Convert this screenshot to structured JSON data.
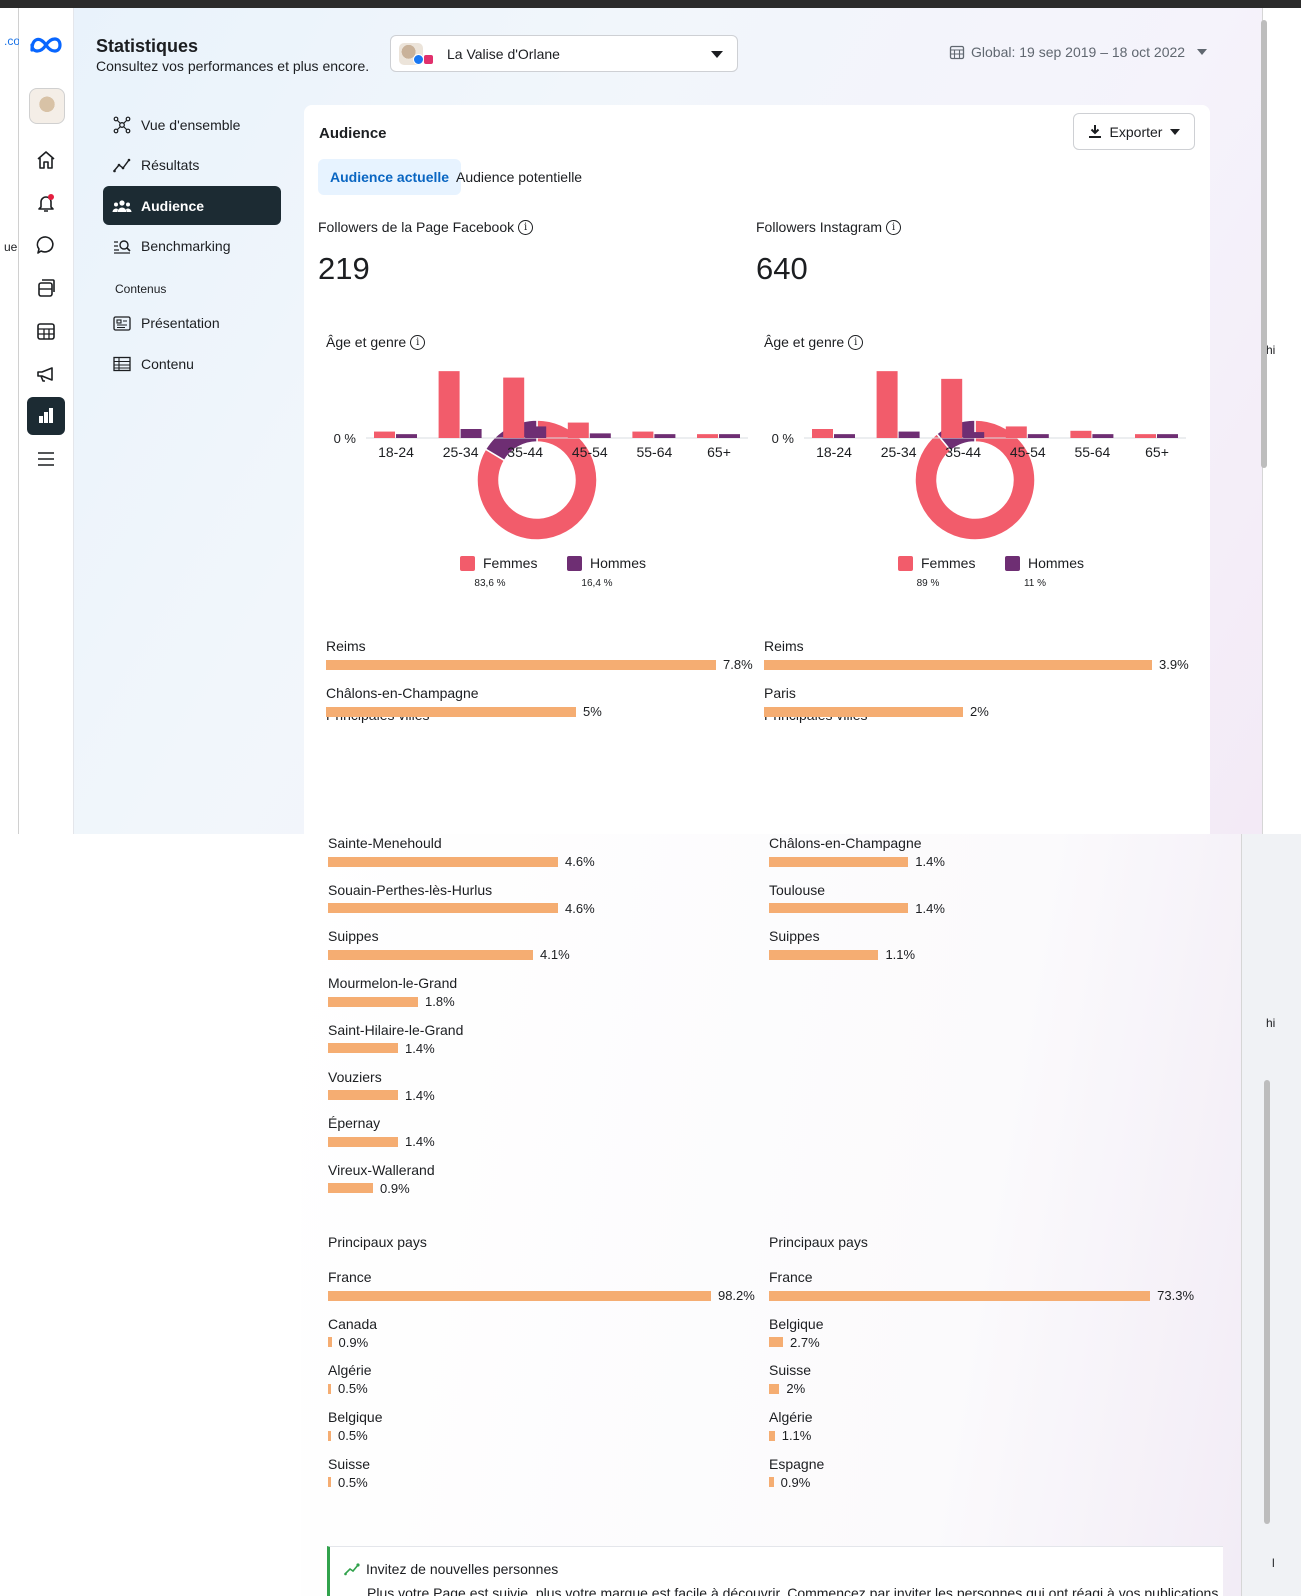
{
  "app": {
    "title": "Statistiques",
    "subtitle": "Consultez vos performances et plus encore."
  },
  "page_selector": {
    "name": "La Valise d'Orlane"
  },
  "date_range": {
    "label": "Global: 19 sep 2019 – 18 oct 2022"
  },
  "left_edge_fragments": [
    ".co",
    "ue"
  ],
  "right_edge_fragments": [
    "hi",
    "hi",
    "l"
  ],
  "rail": {
    "icons": [
      "meta-logo-icon",
      "home-icon",
      "bell-icon",
      "chat-icon",
      "posts-icon",
      "planner-icon",
      "megaphone-icon",
      "insights-icon",
      "menu-icon"
    ]
  },
  "nav": {
    "items": [
      {
        "label": "Vue d'ensemble",
        "icon": "overview-icon"
      },
      {
        "label": "Résultats",
        "icon": "results-icon"
      },
      {
        "label": "Audience",
        "icon": "audience-icon",
        "active": true
      },
      {
        "label": "Benchmarking",
        "icon": "benchmark-icon"
      }
    ],
    "section_label": "Contenus",
    "content_items": [
      {
        "label": "Présentation",
        "icon": "presentation-icon"
      },
      {
        "label": "Contenu",
        "icon": "table-icon"
      }
    ]
  },
  "card": {
    "title": "Audience",
    "export_label": "Exporter",
    "tabs": [
      {
        "label": "Audience actuelle",
        "active": true
      },
      {
        "label": "Audience potentielle",
        "active": false
      }
    ]
  },
  "facebook": {
    "followers_label": "Followers de la Page Facebook",
    "followers_count": "219",
    "age_gender_label": "Âge et genre",
    "cities_label": "Principales villes",
    "countries_label": "Principaux pays"
  },
  "instagram": {
    "followers_label": "Followers Instagram",
    "followers_count": "640",
    "age_gender_label": "Âge et genre",
    "cities_label": "Principales villes",
    "countries_label": "Principaux pays"
  },
  "colors": {
    "women": "#f25c6b",
    "men": "#6e2e73",
    "bar": "#f5ad72",
    "active_nav": "#1c2b33",
    "tab_active_bg": "#e7f3ff",
    "tab_active_text": "#0a66c2"
  },
  "chart_data": [
    {
      "type": "pie",
      "id": "fb-donut",
      "categories": [
        "Femmes",
        "Hommes"
      ],
      "values": [
        83.6,
        16.4
      ],
      "value_labels": [
        "83,6 %",
        "16,4 %"
      ]
    },
    {
      "type": "bar",
      "id": "fb-age",
      "categories": [
        "18-24",
        "25-34",
        "35-44",
        "45-54",
        "55-64",
        "65+"
      ],
      "series": [
        {
          "name": "Femmes",
          "values": [
            2.5,
            26,
            23.5,
            6,
            2.5,
            1.5
          ]
        },
        {
          "name": "Hommes",
          "values": [
            1.5,
            3.5,
            4.5,
            1.8,
            1.5,
            1.5
          ]
        }
      ],
      "ytick_label": "0 %",
      "ylim": [
        0,
        28
      ]
    },
    {
      "type": "pie",
      "id": "ig-donut",
      "categories": [
        "Femmes",
        "Hommes"
      ],
      "values": [
        89,
        11
      ],
      "value_labels": [
        "89 %",
        "11 %"
      ]
    },
    {
      "type": "bar",
      "id": "ig-age",
      "categories": [
        "18-24",
        "25-34",
        "35-44",
        "45-54",
        "55-64",
        "65+"
      ],
      "series": [
        {
          "name": "Femmes",
          "values": [
            3.5,
            26,
            23,
            4.5,
            2.8,
            1.5
          ]
        },
        {
          "name": "Hommes",
          "values": [
            1.5,
            2.5,
            2.3,
            1.5,
            1.5,
            1.5
          ]
        }
      ],
      "ytick_label": "0 %",
      "ylim": [
        0,
        28
      ]
    },
    {
      "type": "bar",
      "id": "fb-cities",
      "orientation": "horizontal",
      "categories": [
        "Reims",
        "Châlons-en-Champagne",
        "Sainte-Menehould",
        "Souain-Perthes-lès-Hurlus",
        "Suippes",
        "Mourmelon-le-Grand",
        "Saint-Hilaire-le-Grand",
        "Vouziers",
        "Épernay",
        "Vireux-Wallerand"
      ],
      "values": [
        7.8,
        5,
        4.6,
        4.6,
        4.1,
        1.8,
        1.4,
        1.4,
        1.4,
        0.9
      ],
      "value_labels": [
        "7.8%",
        "5%",
        "4.6%",
        "4.6%",
        "4.1%",
        "1.8%",
        "1.4%",
        "1.4%",
        "1.4%",
        "0.9%"
      ]
    },
    {
      "type": "bar",
      "id": "ig-cities",
      "orientation": "horizontal",
      "categories": [
        "Reims",
        "Paris",
        "Châlons-en-Champagne",
        "Toulouse",
        "Suippes"
      ],
      "values": [
        3.9,
        2,
        1.4,
        1.4,
        1.1
      ],
      "value_labels": [
        "3.9%",
        "2%",
        "1.4%",
        "1.4%",
        "1.1%"
      ]
    },
    {
      "type": "bar",
      "id": "fb-countries",
      "orientation": "horizontal",
      "categories": [
        "France",
        "Canada",
        "Algérie",
        "Belgique",
        "Suisse"
      ],
      "values": [
        98.2,
        0.9,
        0.5,
        0.5,
        0.5
      ],
      "value_labels": [
        "98.2%",
        "0.9%",
        "0.5%",
        "0.5%",
        "0.5%"
      ]
    },
    {
      "type": "bar",
      "id": "ig-countries",
      "orientation": "horizontal",
      "categories": [
        "France",
        "Belgique",
        "Suisse",
        "Algérie",
        "Espagne"
      ],
      "values": [
        73.3,
        2.7,
        2,
        1.1,
        0.9
      ],
      "value_labels": [
        "73.3%",
        "2.7%",
        "2%",
        "1.1%",
        "0.9%"
      ]
    }
  ],
  "invite": {
    "title": "Invitez de nouvelles personnes",
    "body": "Plus votre Page est suivie, plus votre marque est facile à découvrir. Commencez par inviter les personnes qui ont réagi à vos publications"
  }
}
